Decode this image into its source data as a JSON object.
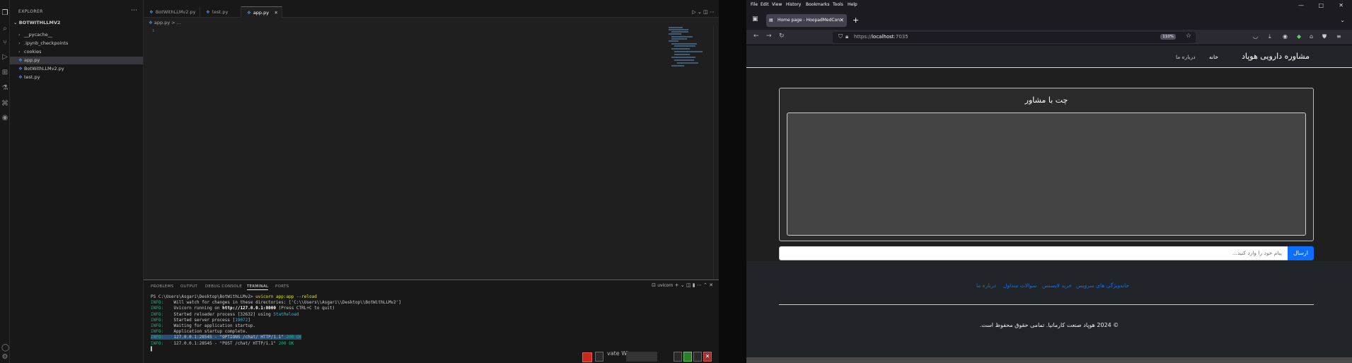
{
  "vscode": {
    "explorer_title": "EXPLORER",
    "root_folder": "BOTWITHLLMV2",
    "tree": [
      {
        "label": "__pycache__",
        "kind": "folder"
      },
      {
        "label": ".ipynb_checkpoints",
        "kind": "folder"
      },
      {
        "label": "cookies",
        "kind": "folder"
      },
      {
        "label": "app.py",
        "kind": "py",
        "selected": true
      },
      {
        "label": "BotWithLLMv2.py",
        "kind": "py"
      },
      {
        "label": "test.py",
        "kind": "py"
      }
    ],
    "tabs": [
      {
        "label": "BotWithLLMv2.py"
      },
      {
        "label": "test.py"
      },
      {
        "label": "app.py",
        "active": true
      }
    ],
    "breadcrumb": "app.py > ...",
    "line_number": "1",
    "panel_tabs": [
      "PROBLEMS",
      "OUTPUT",
      "DEBUG CONSOLE",
      "TERMINAL",
      "PORTS"
    ],
    "active_panel_tab": "TERMINAL",
    "terminal_name": "uvicorn",
    "terminal": {
      "prompt": "PS C:\\Users\\Asgari\\Desktop\\BotWithLLMv2> ",
      "command": "uvicorn app:app --reload",
      "lines": [
        {
          "tag": "INFO:",
          "text": "    Will watch for changes in these directories: ['C:\\\\Users\\\\Asgari\\\\Desktop\\\\BotWithLLMv2']"
        },
        {
          "tag": "INFO:",
          "text": "    Uvicorn running on ",
          "url": "http://127.0.0.1:8000",
          "rest": " (Press CTRL+C to quit)"
        },
        {
          "tag": "INFO:",
          "text": "    Started reloader process [32632] using ",
          "extra": "StatReload"
        },
        {
          "tag": "INFO:",
          "text": "    Started server process [",
          "pid": "19072",
          "rest": "]"
        },
        {
          "tag": "INFO:",
          "text": "    Waiting for application startup."
        },
        {
          "tag": "INFO:",
          "text": "    Application startup complete."
        },
        {
          "tag": "INFO:",
          "text": "    127.0.0.1:28545 - \"OPTIONS /chat/ HTTP/1.1\" ",
          "status": "200 OK",
          "highlight": true
        },
        {
          "tag": "INFO:",
          "text": "    127.0.0.1:28545 - \"POST /chat/ HTTP/1.1\" ",
          "status": "200 OK"
        }
      ]
    },
    "taskbar_text": "vate Win"
  },
  "firefox": {
    "menu": [
      "File",
      "Edit",
      "View",
      "History",
      "Bookmarks",
      "Tools",
      "Help"
    ],
    "tab_title": "Home page - HoopadMedCon",
    "url_prefix": "https://",
    "url_host": "localhost",
    "url_rest": ":7035",
    "zoom": "110%"
  },
  "site": {
    "brand": "مشاوره دارویی هوپاد",
    "nav": [
      "خانه",
      "درباره ما"
    ],
    "chat_title": "چت با مشاور",
    "input_placeholder": "پیام خود را وارد کنید...",
    "send_label": "ارسال",
    "footer_links": [
      "خانه",
      "ویژگی های سرویس",
      "خرید لایسنس",
      "سوالات متداول",
      "درباره ما"
    ],
    "copyright": "© 2024 هوپاد صنعت کارمانیا. تمامی حقوق محفوظ است."
  }
}
